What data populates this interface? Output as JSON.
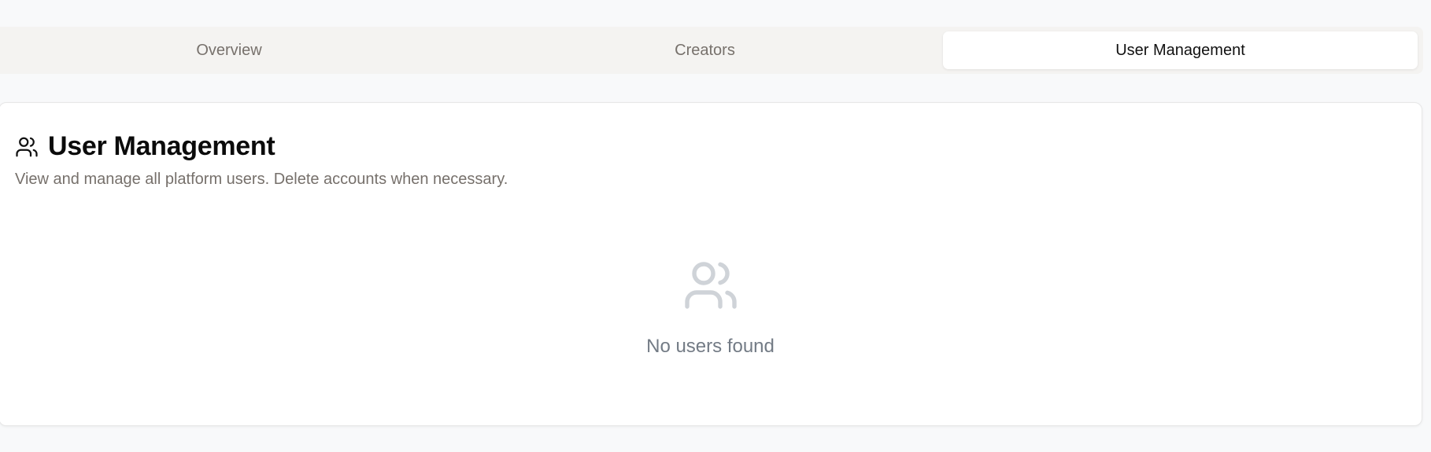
{
  "tabs": [
    {
      "label": "Overview"
    },
    {
      "label": "Creators"
    },
    {
      "label": "User Management"
    }
  ],
  "active_tab": "User Management",
  "card": {
    "icon": "users-icon",
    "title": "User Management",
    "subtitle": "View and manage all platform users. Delete accounts when necessary."
  },
  "empty_state": {
    "icon": "users-icon",
    "message": "No users found"
  },
  "colors": {
    "background": "#f8f9fa",
    "tab_bar": "#f4f3f1",
    "active_tab": "#ffffff",
    "muted_text": "#76706b",
    "empty_icon": "#cfd3d8",
    "empty_text": "#737b85"
  }
}
